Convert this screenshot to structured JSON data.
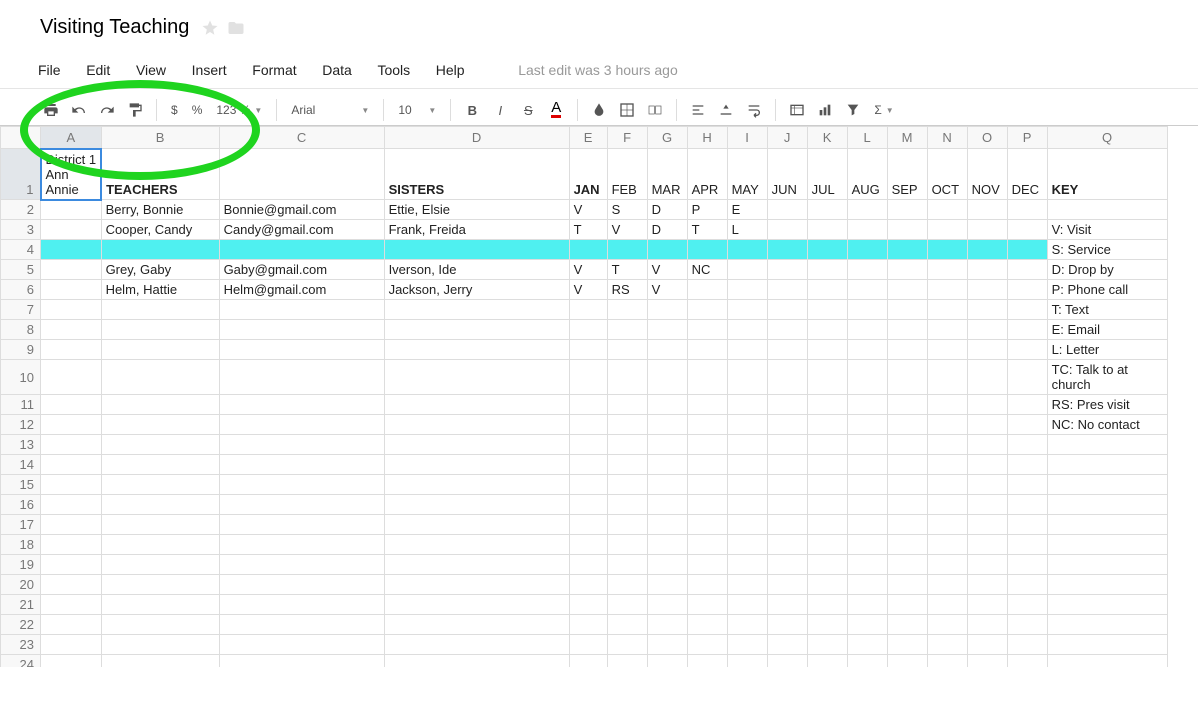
{
  "title": "Visiting Teaching",
  "menu": {
    "file": "File",
    "edit": "Edit",
    "view": "View",
    "insert": "Insert",
    "format": "Format",
    "data": "Data",
    "tools": "Tools",
    "help": "Help"
  },
  "last_edit": "Last edit was 3 hours ago",
  "toolbar": {
    "zoom": "123 %",
    "font": "Arial",
    "size": "10",
    "sigma": "Σ"
  },
  "columns": [
    "A",
    "B",
    "C",
    "D",
    "E",
    "F",
    "G",
    "H",
    "I",
    "J",
    "K",
    "L",
    "M",
    "N",
    "O",
    "P",
    "Q"
  ],
  "col_widths": {
    "A": 60,
    "B": 118,
    "C": 165,
    "D": 185,
    "E": 38,
    "F": 40,
    "G": 40,
    "H": 40,
    "I": 40,
    "J": 40,
    "K": 40,
    "L": 40,
    "M": 40,
    "N": 40,
    "O": 40,
    "P": 40,
    "Q": 120
  },
  "selected_col": "A",
  "selected_row": 1,
  "highlight_row": 4,
  "num_rows": 25,
  "cells": {
    "1": {
      "A": "District 1\nAnn\nAnnie",
      "B": "TEACHERS",
      "D": "SISTERS",
      "E": "JAN",
      "F": "FEB",
      "G": "MAR",
      "H": "APR",
      "I": "MAY",
      "J": "JUN",
      "K": "JUL",
      "L": "AUG",
      "M": "SEP",
      "N": "OCT",
      "O": "NOV",
      "P": "DEC",
      "Q": "KEY"
    },
    "2": {
      "B": "Berry, Bonnie",
      "C": "Bonnie@gmail.com",
      "D": "Ettie, Elsie",
      "E": "V",
      "F": "S",
      "G": "D",
      "H": "P",
      "I": "E",
      "Q": ""
    },
    "3": {
      "B": "Cooper, Candy",
      "C": "Candy@gmail.com",
      "D": "Frank, Freida",
      "E": "T",
      "F": "V",
      "G": "D",
      "H": "T",
      "I": "L",
      "Q": "V: Visit"
    },
    "4": {
      "Q": "S: Service"
    },
    "5": {
      "B": "Grey, Gaby",
      "C": "Gaby@gmail.com",
      "D": "Iverson, Ide",
      "E": "V",
      "F": "T",
      "G": "V",
      "H": "NC",
      "Q": "D: Drop by"
    },
    "6": {
      "B": "Helm, Hattie",
      "C": "Helm@gmail.com",
      "D": "Jackson, Jerry",
      "E": "V",
      "F": "RS",
      "G": "V",
      "Q": "P: Phone call"
    },
    "7": {
      "Q": "T: Text"
    },
    "8": {
      "Q": "E: Email"
    },
    "9": {
      "Q": "L: Letter"
    },
    "10": {
      "Q": "TC: Talk to at church"
    },
    "11": {
      "Q": "RS: Pres visit"
    },
    "12": {
      "Q": "NC: No contact"
    }
  },
  "bold_cells": [
    "1B",
    "1D",
    "1E",
    "1Q"
  ],
  "q_top_border_row": 3
}
